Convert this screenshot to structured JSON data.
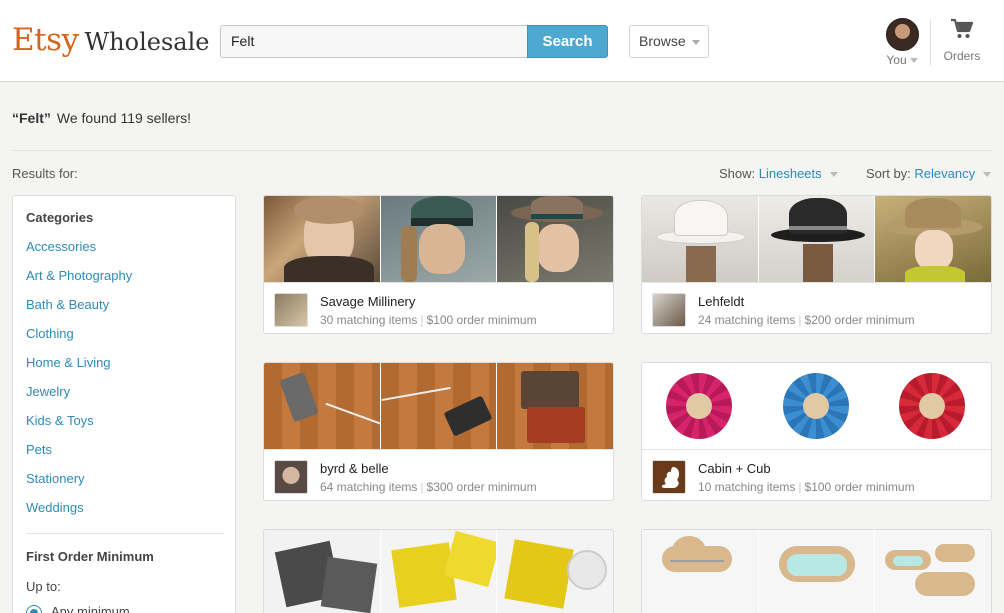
{
  "header": {
    "logo_brand": "Etsy",
    "logo_product": "Wholesale",
    "search_value": "Felt",
    "search_button": "Search",
    "browse_label": "Browse",
    "you_label": "You",
    "orders_label": "Orders"
  },
  "results": {
    "query": "“Felt”",
    "summary": "We found 119 sellers!",
    "results_for": "Results for:",
    "show_label": "Show:",
    "show_value": "Linesheets",
    "sort_label": "Sort by:",
    "sort_value": "Relevancy"
  },
  "sidebar": {
    "categories_heading": "Categories",
    "categories": [
      "Accessories",
      "Art & Photography",
      "Bath & Beauty",
      "Clothing",
      "Home & Living",
      "Jewelry",
      "Kids & Toys",
      "Pets",
      "Stationery",
      "Weddings"
    ],
    "minimum_heading": "First Order Minimum",
    "up_to": "Up to:",
    "radio_option": "Any minimum"
  },
  "sellers": [
    {
      "name": "Savage Millinery",
      "matching": "30 matching items",
      "minimum": "$100 order minimum"
    },
    {
      "name": "Lehfeldt",
      "matching": "24 matching items",
      "minimum": "$200 order minimum"
    },
    {
      "name": "byrd & belle",
      "matching": "64 matching items",
      "minimum": "$300 order minimum"
    },
    {
      "name": "Cabin + Cub",
      "matching": "10 matching items",
      "minimum": "$100 order minimum"
    },
    {
      "name": "",
      "matching": "",
      "minimum": ""
    },
    {
      "name": "",
      "matching": "",
      "minimum": ""
    }
  ],
  "colors": {
    "brand_orange": "#d5641c",
    "accent_blue": "#4fa8cf",
    "link_blue": "#2d8bb5"
  }
}
